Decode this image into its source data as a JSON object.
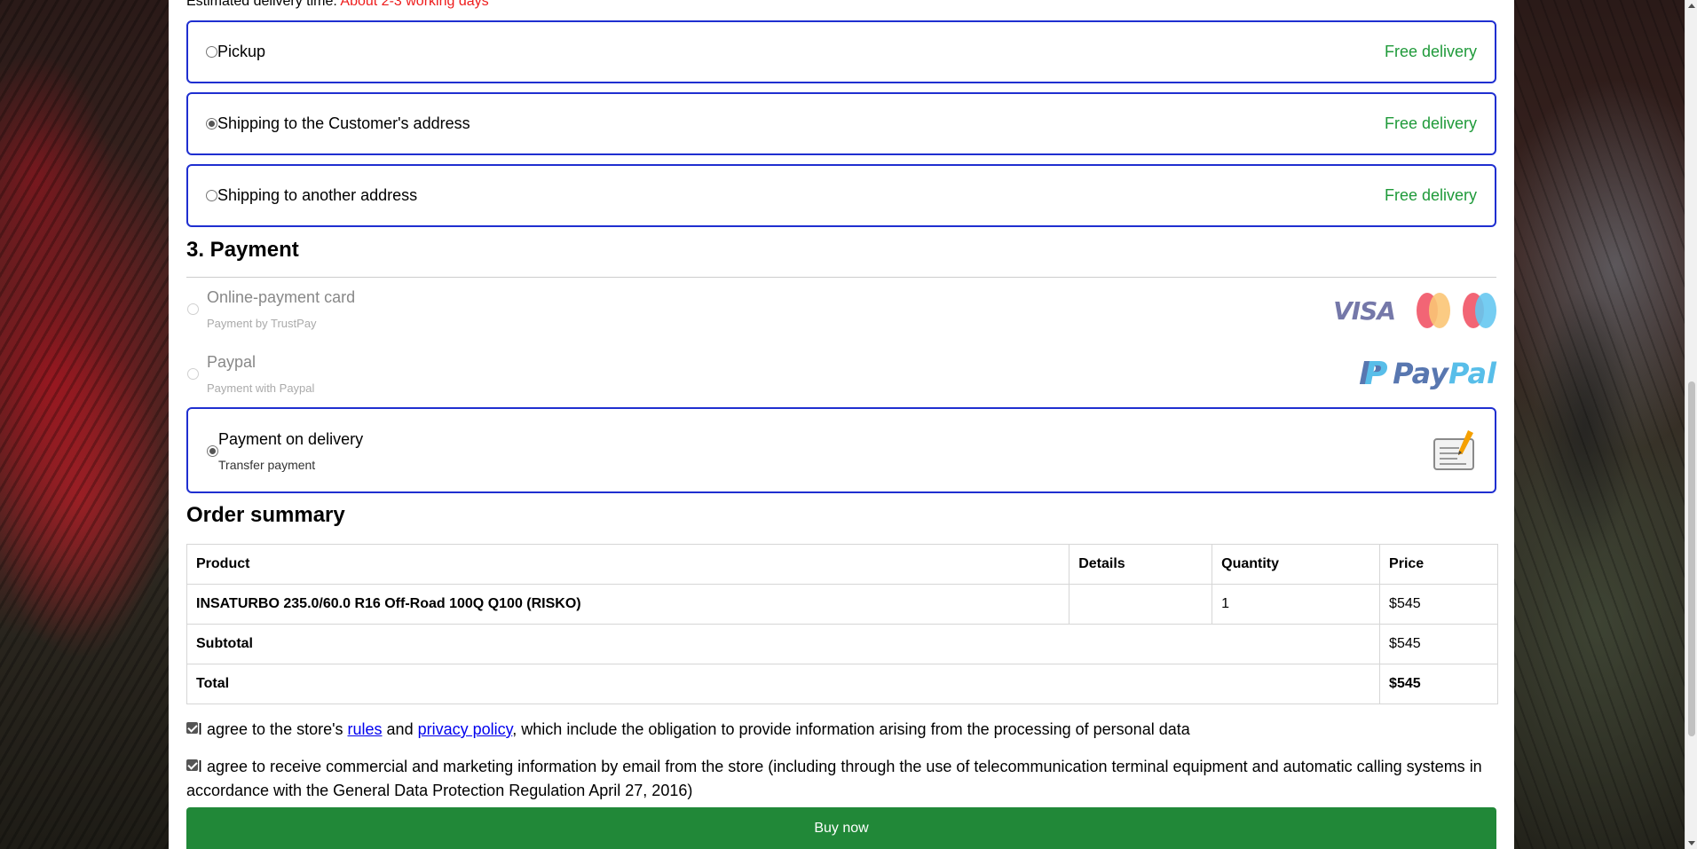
{
  "delivery": {
    "estimate_label": "Estimated delivery time:",
    "estimate_value": "About 2-3 working days",
    "options": [
      {
        "label": "Pickup",
        "price": "Free delivery",
        "selected": false
      },
      {
        "label": "Shipping to the Customer's address",
        "price": "Free delivery",
        "selected": true
      },
      {
        "label": "Shipping to another address",
        "price": "Free delivery",
        "selected": false
      }
    ]
  },
  "payment": {
    "heading": "3. Payment",
    "methods": [
      {
        "title": "Online-payment card",
        "subtitle": "Payment by TrustPay",
        "icons": [
          "visa-logo",
          "mastercard-logo",
          "maestro-logo"
        ],
        "visa_text": "VISA",
        "enabled": false
      },
      {
        "title": "Paypal",
        "subtitle": "Payment with Paypal",
        "icons": [
          "paypal-logo"
        ],
        "logo_text_a": "Pay",
        "logo_text_b": "Pal",
        "enabled": false
      },
      {
        "title": "Payment on delivery",
        "subtitle": "Transfer payment",
        "icons": [
          "document-pencil-icon"
        ],
        "enabled": true,
        "selected": true
      }
    ]
  },
  "summary": {
    "heading": "Order summary",
    "columns": [
      "Product",
      "Details",
      "Quantity",
      "Price"
    ],
    "rows": [
      {
        "product": "INSATURBO 235.0/60.0 R16 Off-Road 100Q Q100 (RISKO)",
        "details": "",
        "quantity": "1",
        "price": "$545"
      }
    ],
    "subtotal_label": "Subtotal",
    "subtotal_value": "$545",
    "total_label": "Total",
    "total_value": "$545"
  },
  "consents": {
    "terms_pre": "I agree to the store's ",
    "terms_rules_link": "rules",
    "terms_and": " and ",
    "terms_privacy_link": "privacy policy",
    "terms_post": ", which include the obligation to provide information arising from the processing of personal data",
    "marketing": "I agree to receive commercial and marketing information by email from the store (including through the use of telecommunication terminal equipment and automatic calling systems in accordance with the General Data Protection Regulation April 27, 2016)"
  },
  "actions": {
    "buy_label": "Buy now"
  },
  "colors": {
    "accent_border": "#1f2fd0",
    "free_delivery": "#1f9a3a",
    "estimate_red": "#ee1c1c",
    "buy_button": "#218838",
    "link": "#0000ee"
  }
}
